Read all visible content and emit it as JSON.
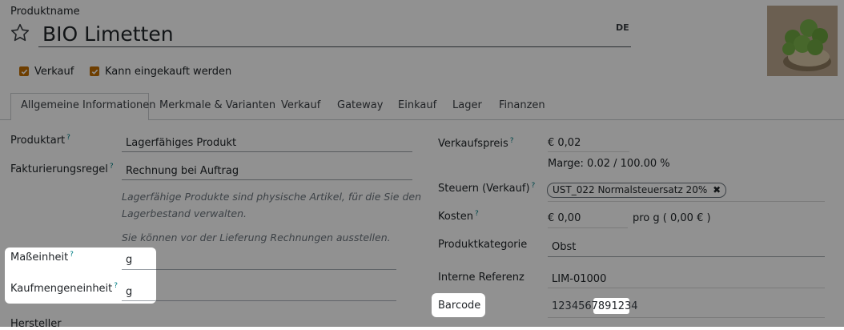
{
  "header": {
    "product_name_label": "Produktname",
    "product_name_value": "BIO Limetten",
    "lang_badge": "DE",
    "favorite_icon": "star-icon"
  },
  "flags": {
    "sale_label": "Verkauf",
    "purchase_label": "Kann eingekauft werden"
  },
  "tabs": [
    {
      "label": "Allgemeine Informationen",
      "active": true
    },
    {
      "label": "Merkmale & Varianten"
    },
    {
      "label": "Verkauf"
    },
    {
      "label": "Gateway"
    },
    {
      "label": "Einkauf"
    },
    {
      "label": "Lager"
    },
    {
      "label": "Finanzen"
    }
  ],
  "left": {
    "product_type_label": "Produktart",
    "product_type_value": "Lagerfähiges Produkt",
    "invoice_policy_label": "Fakturierungsregel",
    "invoice_policy_value": "Rechnung bei Auftrag",
    "hint_storable": "Lagerfähige Produkte sind physische Artikel, für die Sie den",
    "hint_storable2": "Lagerbestand verwalten.",
    "hint_invoice": "Sie können vor der Lieferung Rechnungen ausstellen.",
    "uom_label": "Maßeinheit",
    "uom_value": "g",
    "purchase_uom_label": "Kaufmengeneinheit",
    "purchase_uom_value": "g",
    "manufacturer_label": "Hersteller"
  },
  "right": {
    "sales_price_label": "Verkaufspreis",
    "sales_price_value": "€ 0,02",
    "margin_text": "Marge: 0.02 / 100.00 %",
    "taxes_label": "Steuern (Verkauf)",
    "tax_tag": "UST_022 Normalsteuersatz 20%",
    "cost_label": "Kosten",
    "cost_value": "€ 0,00",
    "cost_per": "pro g ( 0,00 € )",
    "category_label": "Produktkategorie",
    "category_value": "Obst",
    "internal_ref_label": "Interne Referenz",
    "internal_ref_value": "LIM-01000",
    "barcode_label": "Barcode",
    "barcode_value": "1234567891234"
  },
  "help_mark": "?"
}
